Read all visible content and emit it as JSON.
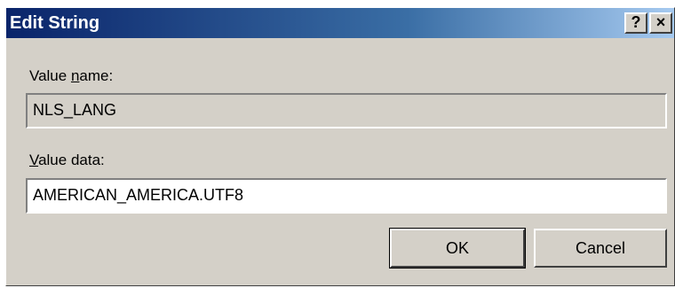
{
  "window": {
    "title": "Edit String",
    "help_label": "?",
    "close_label": "×"
  },
  "value_name": {
    "label_underlined": "n",
    "label_before": "Value ",
    "label_after": "ame:",
    "value": "NLS_LANG"
  },
  "value_data": {
    "label_underlined": "V",
    "label_after": "alue data:",
    "value": "AMERICAN_AMERICA.UTF8"
  },
  "buttons": {
    "ok_label": "OK",
    "cancel_label": "Cancel"
  },
  "colors": {
    "titlebar_start": "#0a246a",
    "titlebar_end": "#a6caf0",
    "dialog_face": "#d4d0c8"
  }
}
